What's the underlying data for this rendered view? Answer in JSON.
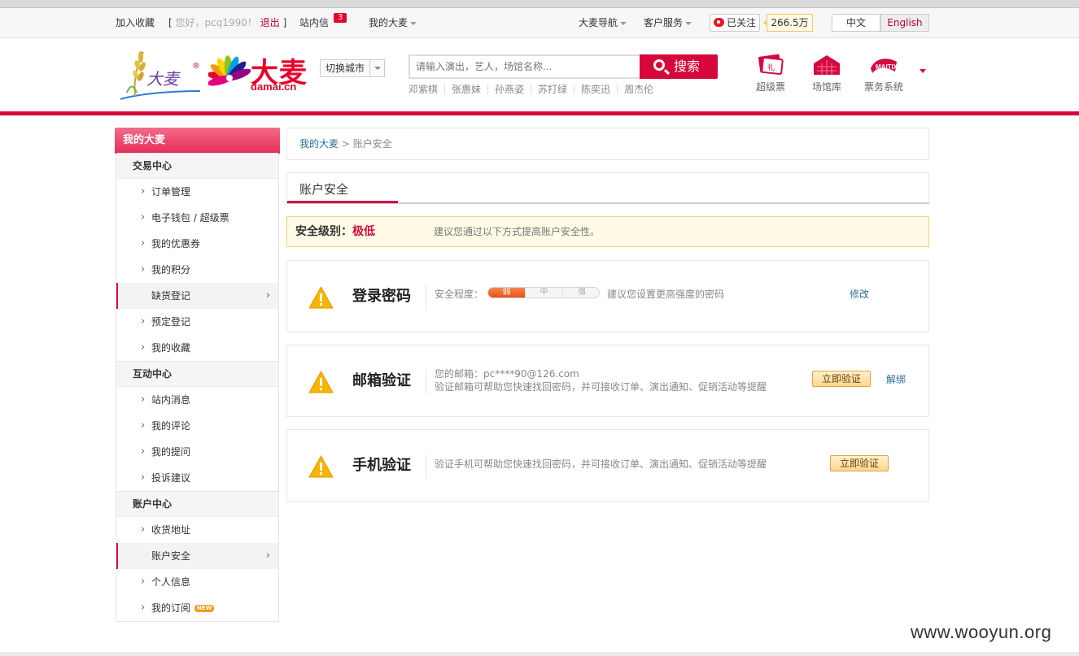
{
  "topbar": {
    "bookmark": "加入收藏",
    "greeting": "您好，pcq1990！",
    "logout": "退出",
    "inbox": "站内信",
    "inbox_count": "3",
    "my_damai": "我的大麦",
    "site_nav": "大麦导航",
    "customer_service": "客户服务",
    "weibo_follow": "已关注",
    "weibo_fans": "266.5万",
    "lang_zh": "中文",
    "lang_en": "English"
  },
  "header": {
    "logo_cn": "大麦",
    "logo_domain": "damai.cn",
    "switch_city": "切换城市",
    "search_placeholder": "请输入演出，艺人，场馆名称...",
    "search_button": "搜索",
    "hot_keywords": [
      "邓紫棋",
      "张惠妹",
      "孙燕姿",
      "苏打绿",
      "陈奕迅",
      "周杰伦"
    ],
    "quick_links": [
      "超级票",
      "场馆库",
      "票务系统"
    ]
  },
  "sidebar": {
    "title": "我的大麦",
    "sections": [
      {
        "label": "交易中心",
        "items": [
          "订单管理",
          "电子钱包 / 超级票",
          "我的优惠券",
          "我的积分",
          "缺货登记",
          "预定登记",
          "我的收藏"
        ]
      },
      {
        "label": "互动中心",
        "items": [
          "站内消息",
          "我的评论",
          "我的提问",
          "投诉建议"
        ]
      },
      {
        "label": "账户中心",
        "items": [
          "收货地址",
          "账户安全",
          "个人信息",
          "我的订阅"
        ]
      }
    ],
    "new_tag": "NEW"
  },
  "breadcrumb": {
    "root": "我的大麦",
    "sep": " > ",
    "current": "账户安全"
  },
  "tab": {
    "label": "账户安全"
  },
  "security_level": {
    "label": "安全级别：",
    "value": "极低",
    "tip": "建议您通过以下方式提高账户安全性。"
  },
  "cards": {
    "password": {
      "title": "登录密码",
      "strength_label": "安全程度：",
      "strength_levels": [
        "弱",
        "中",
        "强"
      ],
      "strength_current": 1,
      "tip": "建议您设置更高强度的密码",
      "action": "修改"
    },
    "email": {
      "title": "邮箱验证",
      "email_line": "您的邮箱：pc****90@126.com",
      "desc": "验证邮箱可帮助您快速找回密码，并可接收订单、演出通知、促销活动等提醒",
      "action": "立即验证",
      "unbind": "解绑"
    },
    "phone": {
      "title": "手机验证",
      "desc": "验证手机可帮助您快速找回密码，并可接收订单、演出通知、促销活动等提醒",
      "action": "立即验证"
    }
  },
  "watermark": "www.wooyun.org",
  "colors": {
    "brand_red": "#d5093f",
    "warn_yellow": "#f5b400",
    "link_blue": "#2a6e9e"
  }
}
